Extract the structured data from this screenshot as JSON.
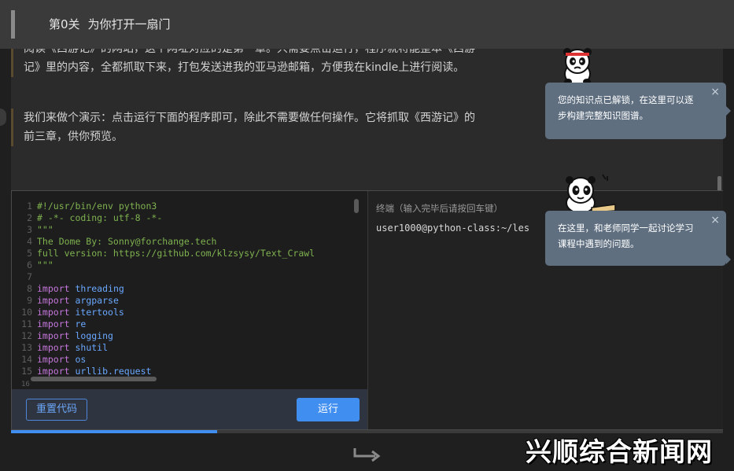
{
  "header": {
    "level": "第0关",
    "title": "为你打开一扇门"
  },
  "lesson": {
    "p1_line1": "阅读《西游记》的网站，这个网址对应的是第一章。只需要点击运行，程序就将能整本《西游",
    "p1_line2": "记》里的内容，全都抓取下来，打包发送进我的亚马逊邮箱，方便我在kindle上进行阅读。",
    "p2_line1": "我们来做个演示：点击运行下面的程序即可，除此不需要做任何操作。它将抓取《西游记》的",
    "p2_line2": "前三章，供你预览。"
  },
  "editor": {
    "lines": [
      {
        "n": "1",
        "code": "#!/usr/bin/env python3",
        "kind": "comment"
      },
      {
        "n": "2",
        "code": "# -*- coding: utf-8 -*-",
        "kind": "comment"
      },
      {
        "n": "3",
        "code": "\"\"\"",
        "kind": "comment"
      },
      {
        "n": "4",
        "code": "The Dome By: Sonny@forchange.tech",
        "kind": "comment"
      },
      {
        "n": "5",
        "code": "full version: https://github.com/klzsysy/Text_Crawl",
        "kind": "comment"
      },
      {
        "n": "6",
        "code": "\"\"\"",
        "kind": "comment"
      },
      {
        "n": "7",
        "code": "",
        "kind": "blank"
      },
      {
        "n": "8",
        "kw": "import",
        "mod": "threading",
        "kind": "import"
      },
      {
        "n": "9",
        "kw": "import",
        "mod": "argparse",
        "kind": "import"
      },
      {
        "n": "10",
        "kw": "import",
        "mod": "itertools",
        "kind": "import"
      },
      {
        "n": "11",
        "kw": "import",
        "mod": "re",
        "kind": "import"
      },
      {
        "n": "12",
        "kw": "import",
        "mod": "logging",
        "kind": "import"
      },
      {
        "n": "13",
        "kw": "import",
        "mod": "shutil",
        "kind": "import"
      },
      {
        "n": "14",
        "kw": "import",
        "mod": "os",
        "kind": "import"
      },
      {
        "n": "15",
        "kw": "import",
        "mod": "urllib.request",
        "kind": "import"
      }
    ],
    "tail_line": "16"
  },
  "terminal": {
    "label": "终端（输入完毕后请按回车键）",
    "prompt": "user1000@python-class:~/les"
  },
  "toolbar": {
    "reset_label": "重置代码",
    "run_label": "运行"
  },
  "progress": {
    "fraction": 0.29
  },
  "tooltips": {
    "tip1_line1": "您的知识点已解锁，在这里可以逐",
    "tip1_line2": "步构建完整知识图谱。",
    "tip2_line1": "在这里，和老师同学一起讨论学习",
    "tip2_line2": "课程中遇到的问题。",
    "close": "×"
  },
  "watermark": "兴顺综合新闻网",
  "colors": {
    "accent": "#3f8ef0",
    "tooltip": "#5f6f80",
    "comment": "#7fb24f",
    "keyword": "#c678dd",
    "identifier": "#6aa8ff"
  }
}
